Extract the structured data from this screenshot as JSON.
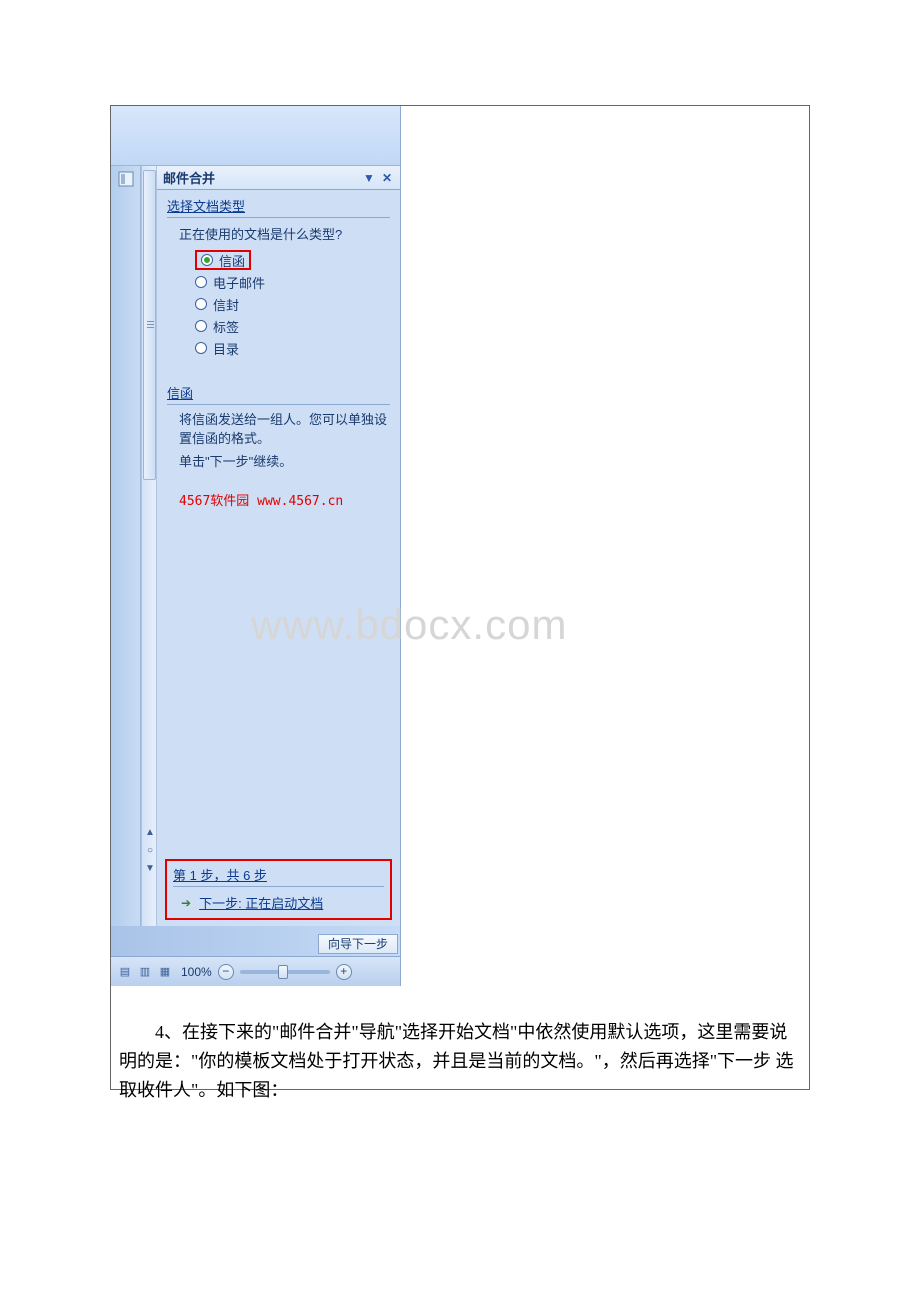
{
  "pane": {
    "title": "邮件合并",
    "section1": {
      "heading": "选择文档类型",
      "question": "正在使用的文档是什么类型?",
      "options": {
        "opt1": "信函",
        "opt2": "电子邮件",
        "opt3": "信封",
        "opt4": "标签",
        "opt5": "目录"
      }
    },
    "section2": {
      "heading": "信函",
      "line1": "将信函发送给一组人。您可以单独设置信函的格式。",
      "line2": "单击\"下一步\"继续。"
    },
    "watermark_link": "4567软件园 www.4567.cn",
    "footer": {
      "step_text": "第 1 步，共 6 步",
      "next_label": "下一步: 正在启动文档"
    },
    "wizard_btn": "向导下一步"
  },
  "statusbar": {
    "zoom_pct": "100%"
  },
  "doc_watermark": "www.bdocx.com",
  "paragraph": "4、在接下来的\"邮件合并\"导航\"选择开始文档\"中依然使用默认选项，这里需要说明的是：\"你的模板文档处于打开状态，并且是当前的文档。\"，然后再选择\"下一步 选取收件人\"。如下图："
}
